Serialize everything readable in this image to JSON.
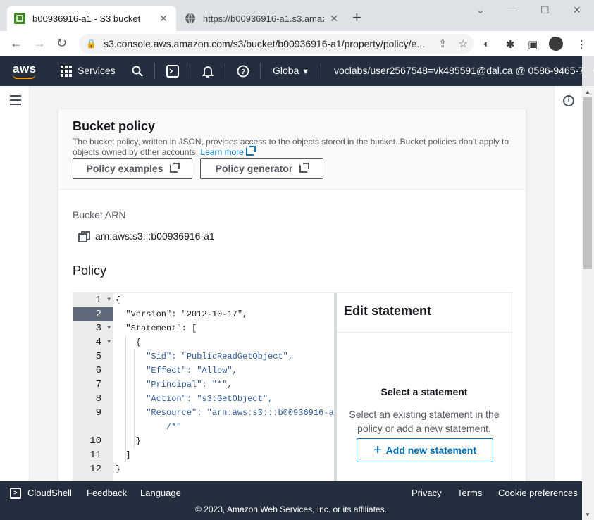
{
  "browser": {
    "tabs": [
      {
        "title": "b00936916-a1 - S3 bucket",
        "close": "✕"
      },
      {
        "title": "https://b00936916-a1.s3.amazon",
        "close": "✕"
      }
    ],
    "new_tab": "+",
    "url": "s3.console.aws.amazon.com/s3/bucket/b00936916-a1/property/policy/e..."
  },
  "aws_nav": {
    "logo": "aws",
    "services": "Services",
    "region": "Globa",
    "account": "voclabs/user2567548=vk485591@dal.ca @ 0586-9465-7"
  },
  "bucket_policy": {
    "title": "Bucket policy",
    "description": "The bucket policy, written in JSON, provides access to the objects stored in the bucket. Bucket policies don't apply to objects owned by other accounts.",
    "learn_more": "Learn more",
    "policy_examples": "Policy examples",
    "policy_generator": "Policy generator",
    "arn_label": "Bucket ARN",
    "arn_value": "arn:aws:s3:::b00936916-a1",
    "policy_heading": "Policy"
  },
  "editor": {
    "line_numbers": [
      "1",
      "2",
      "3",
      "4",
      "5",
      "6",
      "7",
      "8",
      "9",
      "",
      "10",
      "11",
      "12",
      "13"
    ],
    "lines": [
      "{",
      "  \"Version\": \"2012-10-17\",",
      "  \"Statement\": [",
      "    {",
      "      \"Sid\": \"PublicReadGetObject\",",
      "      \"Effect\": \"Allow\",",
      "      \"Principal\": \"*\",",
      "      \"Action\": \"s3:GetObject\",",
      "      \"Resource\": \"arn:aws:s3:::b00936916-a1",
      "          /*\"",
      "    }",
      "  ]",
      "}"
    ]
  },
  "edit_statement": {
    "title": "Edit statement",
    "subtitle": "Select a statement",
    "description": "Select an existing statement in the policy or add a new statement.",
    "add_button": "Add new statement"
  },
  "footer": {
    "cloudshell": "CloudShell",
    "feedback": "Feedback",
    "language": "Language",
    "privacy": "Privacy",
    "terms": "Terms",
    "cookies": "Cookie preferences",
    "copyright": "© 2023, Amazon Web Services, Inc. or its affiliates."
  }
}
